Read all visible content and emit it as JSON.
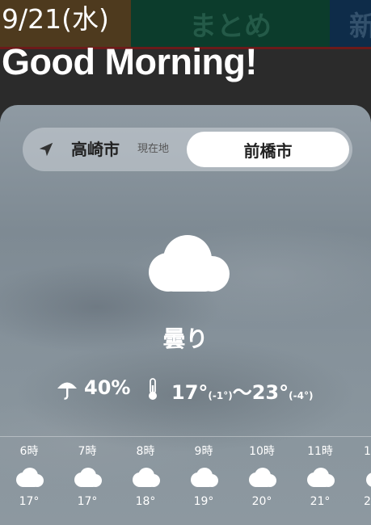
{
  "header": {
    "date": "9/21(水)",
    "greeting": "Good Morning!",
    "tabs": [
      {
        "label": ""
      },
      {
        "label": "まとめ"
      },
      {
        "label": "新"
      }
    ]
  },
  "location": {
    "current_city": "高崎市",
    "current_tag": "現在地",
    "other_city": "前橋市"
  },
  "weather": {
    "icon": "cloud-icon",
    "condition": "曇り",
    "precip_chance": "40%",
    "high": "17°",
    "high_diff": "(-1°)",
    "separator": "〜",
    "low": "23°",
    "low_diff": "(-4°)"
  },
  "hourly": [
    {
      "time": "6時",
      "temp": "17°",
      "icon": "cloud-icon"
    },
    {
      "time": "7時",
      "temp": "17°",
      "icon": "cloud-icon"
    },
    {
      "time": "8時",
      "temp": "18°",
      "icon": "cloud-icon"
    },
    {
      "time": "9時",
      "temp": "19°",
      "icon": "cloud-icon"
    },
    {
      "time": "10時",
      "temp": "20°",
      "icon": "cloud-icon"
    },
    {
      "time": "11時",
      "temp": "21°",
      "icon": "cloud-icon"
    },
    {
      "time": "1",
      "temp": "2",
      "icon": "cloud-icon"
    }
  ],
  "colors": {
    "background": "#2b2b2b",
    "tab_today": "#4e3a1e",
    "tab_summary": "#0c3c2c",
    "tab_new": "#0e2c49"
  }
}
